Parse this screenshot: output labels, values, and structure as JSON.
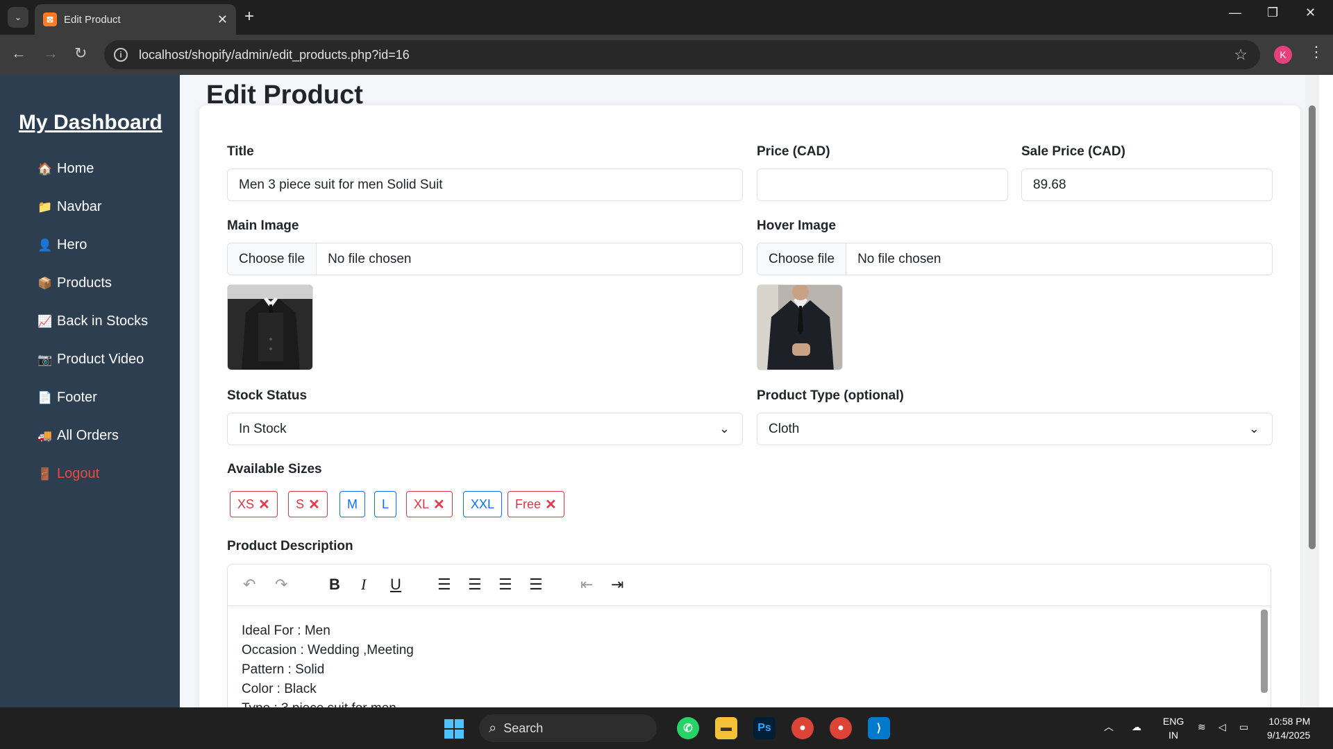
{
  "browser": {
    "tab_title": "Edit Product",
    "url": "localhost/shopify/admin/edit_products.php?id=16",
    "profile_initial": "K"
  },
  "sidebar": {
    "brand": "My Dashboard",
    "items": [
      {
        "icon": "house-icon",
        "glyph": "🏠",
        "label": "Home"
      },
      {
        "icon": "folder-icon",
        "glyph": "📁",
        "label": "Navbar"
      },
      {
        "icon": "person-icon",
        "glyph": "👤",
        "label": "Hero"
      },
      {
        "icon": "package-icon",
        "glyph": "📦",
        "label": "Products"
      },
      {
        "icon": "chart-icon",
        "glyph": "📈",
        "label": "Back in Stocks"
      },
      {
        "icon": "camera-icon",
        "glyph": "📷",
        "label": "Product Video"
      },
      {
        "icon": "document-icon",
        "glyph": "📄",
        "label": "Footer"
      },
      {
        "icon": "truck-icon",
        "glyph": "🚚",
        "label": "All Orders"
      },
      {
        "icon": "door-icon",
        "glyph": "🚪",
        "label": "Logout"
      }
    ]
  },
  "form": {
    "page_title": "Edit Product",
    "title_label": "Title",
    "title_value": "Men 3 piece suit for men Solid Suit",
    "price_label": "Price (CAD)",
    "price_value": "",
    "sale_price_label": "Sale Price (CAD)",
    "sale_price_value": "89.68",
    "main_image_label": "Main Image",
    "hover_image_label": "Hover Image",
    "choose_file": "Choose file",
    "no_file": "No file chosen",
    "stock_label": "Stock Status",
    "stock_value": "In Stock",
    "type_label": "Product Type (optional)",
    "type_value": "Cloth",
    "sizes_label": "Available Sizes",
    "sizes": [
      {
        "label": "XS",
        "selected": true
      },
      {
        "label": "S",
        "selected": true
      },
      {
        "label": "M",
        "selected": false
      },
      {
        "label": "L",
        "selected": false
      },
      {
        "label": "XL",
        "selected": true
      },
      {
        "label": "XXL",
        "selected": false
      },
      {
        "label": "Free",
        "selected": true
      }
    ],
    "description_label": "Product Description",
    "description_lines": [
      "Ideal For :  Men",
      "Occasion :  Wedding ,Meeting",
      "Pattern :  Solid",
      "Color :  Black",
      "Type :  3 piece suit for men"
    ]
  },
  "taskbar": {
    "search": "Search",
    "lang1": "ENG",
    "lang2": "IN",
    "time": "10:58 PM",
    "date": "9/14/2025"
  },
  "colors": {
    "sidebar": "#2c3e50",
    "selected_size": "#dc3545",
    "unselected_size": "#0d6efd",
    "logout": "#e74c3c"
  }
}
